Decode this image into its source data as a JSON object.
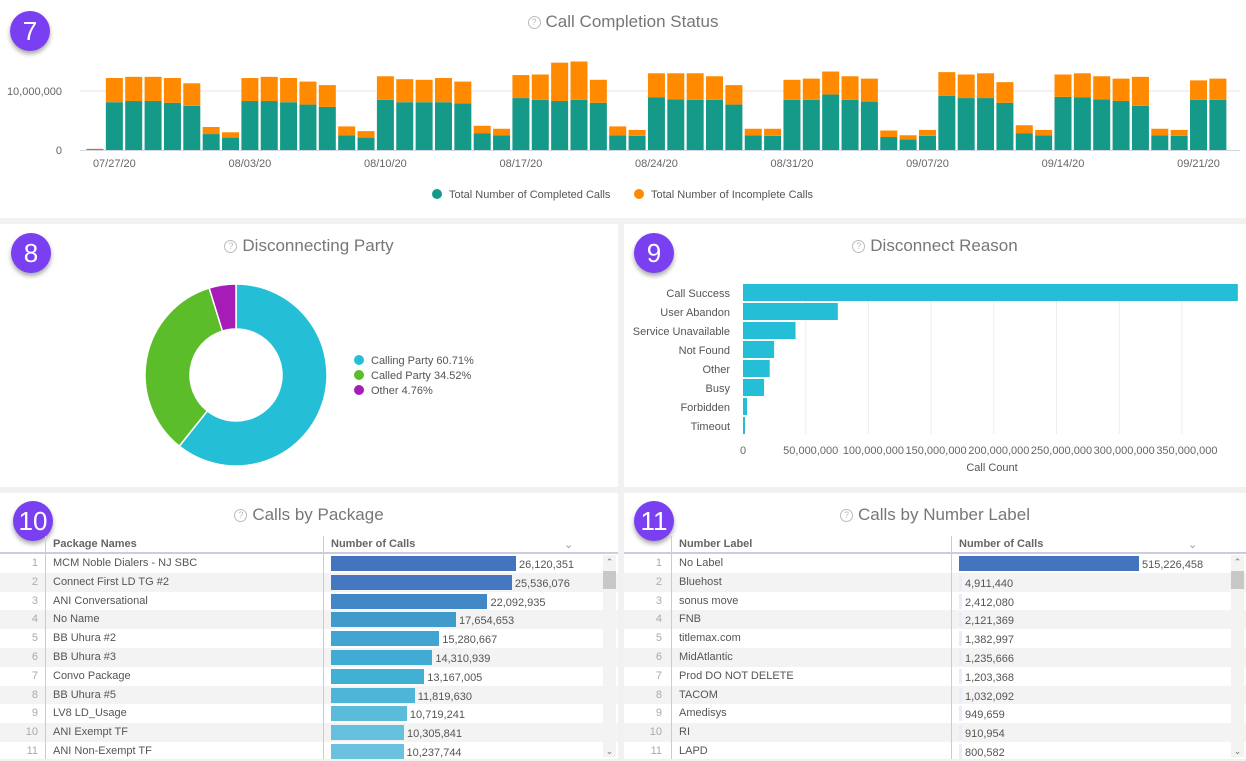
{
  "panels": {
    "completion": {
      "badge": "7",
      "title": "Call Completion Status"
    },
    "party": {
      "badge": "8",
      "title": "Disconnecting Party"
    },
    "reason": {
      "badge": "9",
      "title": "Disconnect Reason"
    },
    "package": {
      "badge": "10",
      "title": "Calls by Package"
    },
    "label": {
      "badge": "11",
      "title": "Calls by Number Label"
    }
  },
  "icons": {
    "help": "question-circle-icon",
    "sort": "chevron-down-icon",
    "scroll_up": "chevron-up-icon",
    "scroll_down": "chevron-down-icon"
  },
  "chart_data": [
    {
      "type": "bar",
      "stacked": true,
      "title": "Call Completion Status",
      "x_start": "07/26/20",
      "x_end": "09/22/20",
      "xticks": [
        "07/27/20",
        "08/03/20",
        "08/10/20",
        "08/17/20",
        "08/24/20",
        "08/31/20",
        "09/07/20",
        "09/14/20",
        "09/21/20"
      ],
      "yticks": [
        "0",
        "10,000,000"
      ],
      "ylim": [
        0,
        16000000
      ],
      "grid": "horizontal",
      "legend": "bottom",
      "series": [
        {
          "name": "Total Number of Completed Calls",
          "color": "#159a89",
          "values": [
            0.15,
            8.1,
            8.3,
            8.3,
            8.0,
            7.5,
            2.7,
            2.1,
            8.3,
            8.3,
            8.1,
            7.7,
            7.3,
            2.5,
            2.1,
            8.5,
            8.1,
            8.1,
            8.1,
            7.9,
            2.8,
            2.5,
            8.8,
            8.5,
            8.3,
            8.5,
            8.0,
            2.5,
            2.4,
            8.9,
            8.6,
            8.5,
            8.5,
            7.7,
            2.5,
            2.4,
            8.5,
            8.5,
            9.4,
            8.5,
            8.2,
            2.2,
            1.8,
            2.4,
            9.2,
            8.8,
            8.8,
            8.0,
            2.8,
            2.5,
            9.0,
            8.9,
            8.6,
            8.3,
            7.5,
            2.5,
            2.4,
            8.5,
            8.5
          ]
        },
        {
          "name": "Total Number of Incomplete Calls",
          "color": "#ff8a00",
          "values": [
            0.05,
            4.1,
            4.1,
            4.1,
            4.2,
            3.8,
            1.2,
            0.9,
            3.9,
            4.1,
            4.1,
            3.9,
            3.7,
            1.5,
            1.1,
            4.0,
            3.9,
            3.8,
            4.1,
            3.7,
            1.3,
            1.1,
            3.9,
            4.3,
            6.5,
            6.5,
            3.9,
            1.5,
            1.0,
            4.1,
            4.4,
            4.5,
            4.0,
            3.3,
            1.1,
            1.2,
            3.4,
            3.6,
            3.9,
            4.0,
            3.9,
            1.1,
            0.7,
            1.0,
            4.0,
            4.0,
            4.2,
            3.5,
            1.4,
            0.9,
            3.8,
            4.1,
            3.9,
            3.8,
            4.9,
            1.1,
            1.0,
            3.3,
            3.6
          ]
        }
      ],
      "unit": "millions"
    },
    {
      "type": "pie",
      "donut": true,
      "title": "Disconnecting Party",
      "legend": "right",
      "slices": [
        {
          "label": "Calling Party 60.71%",
          "value": 60.71,
          "color": "#24bfd6"
        },
        {
          "label": "Called Party 34.52%",
          "value": 34.52,
          "color": "#5bbd2a"
        },
        {
          "label": "Other 4.76%",
          "value": 4.76,
          "color": "#a51cb6"
        }
      ]
    },
    {
      "type": "bar",
      "orientation": "horizontal",
      "title": "Disconnect Reason",
      "xlabel": "Call Count",
      "color": "#24bfd6",
      "grid": "vertical",
      "categories": [
        "Call Success",
        "User Abandon",
        "Service Unavailable",
        "Not Found",
        "Other",
        "Busy",
        "Forbidden",
        "Timeout"
      ],
      "values": [
        394600000,
        75600000,
        41900000,
        24800000,
        21300000,
        16800000,
        3200000,
        1600000
      ],
      "xlim": [
        0,
        394600000
      ],
      "xticks": [
        "0",
        "50,000,000",
        "100,000,000",
        "150,000,000",
        "200,000,000",
        "250,000,000",
        "300,000,000",
        "350,000,000"
      ]
    }
  ],
  "package_table": {
    "col1": "Package Names",
    "col2": "Number of Calls",
    "rows": [
      {
        "n": "1",
        "name": "MCM Noble Dialers - NJ SBC",
        "calls": "26,120,351",
        "v": 26120351,
        "color": "#4474be"
      },
      {
        "n": "2",
        "name": "Connect First LD TG #2",
        "calls": "25,536,076",
        "v": 25536076,
        "color": "#4478c0"
      },
      {
        "n": "3",
        "name": "ANI Conversational",
        "calls": "22,092,935",
        "v": 22092935,
        "color": "#4287c6"
      },
      {
        "n": "4",
        "name": "No Name",
        "calls": "17,654,653",
        "v": 17654653,
        "color": "#409acc"
      },
      {
        "n": "5",
        "name": "BB Uhura #2",
        "calls": "15,280,667",
        "v": 15280667,
        "color": "#40a6d1"
      },
      {
        "n": "6",
        "name": "BB Uhura #3",
        "calls": "14,310,939",
        "v": 14310939,
        "color": "#40abd3"
      },
      {
        "n": "7",
        "name": "Convo Package",
        "calls": "13,167,005",
        "v": 13167005,
        "color": "#42afd5"
      },
      {
        "n": "8",
        "name": "BB Uhura #5",
        "calls": "11,819,630",
        "v": 11819630,
        "color": "#4fb5d8"
      },
      {
        "n": "9",
        "name": "LV8 LD_Usage",
        "calls": "10,719,241",
        "v": 10719241,
        "color": "#5bbbdb"
      },
      {
        "n": "10",
        "name": "ANI Exempt TF",
        "calls": "10,305,841",
        "v": 10305841,
        "color": "#65c0de"
      },
      {
        "n": "11",
        "name": "ANI Non-Exempt TF",
        "calls": "10,237,744",
        "v": 10237744,
        "color": "#6ac2df"
      }
    ]
  },
  "label_table": {
    "col1": "Number Label",
    "col2": "Number of Calls",
    "rows": [
      {
        "n": "1",
        "name": "No Label",
        "calls": "515,226,458",
        "v": 515226458,
        "color": "#4474be"
      },
      {
        "n": "2",
        "name": "Bluehost",
        "calls": "4,911,440",
        "v": 4911440,
        "color": "#e8eef8"
      },
      {
        "n": "3",
        "name": "sonus move",
        "calls": "2,412,080",
        "v": 2412080,
        "color": "#e8eef8"
      },
      {
        "n": "4",
        "name": "FNB",
        "calls": "2,121,369",
        "v": 2121369,
        "color": "#e8eef8"
      },
      {
        "n": "5",
        "name": "titlemax.com",
        "calls": "1,382,997",
        "v": 1382997,
        "color": "#e8eef8"
      },
      {
        "n": "6",
        "name": "MidAtlantic",
        "calls": "1,235,666",
        "v": 1235666,
        "color": "#e8eef8"
      },
      {
        "n": "7",
        "name": "Prod DO NOT DELETE",
        "calls": "1,203,368",
        "v": 1203368,
        "color": "#e8eef8"
      },
      {
        "n": "8",
        "name": "TACOM",
        "calls": "1,032,092",
        "v": 1032092,
        "color": "#e8eef8"
      },
      {
        "n": "9",
        "name": "Amedisys",
        "calls": "949,659",
        "v": 949659,
        "color": "#e8eef8"
      },
      {
        "n": "10",
        "name": "RI",
        "calls": "910,954",
        "v": 910954,
        "color": "#e8eef8"
      },
      {
        "n": "11",
        "name": "LAPD",
        "calls": "800,582",
        "v": 800582,
        "color": "#e8eef8"
      }
    ]
  }
}
